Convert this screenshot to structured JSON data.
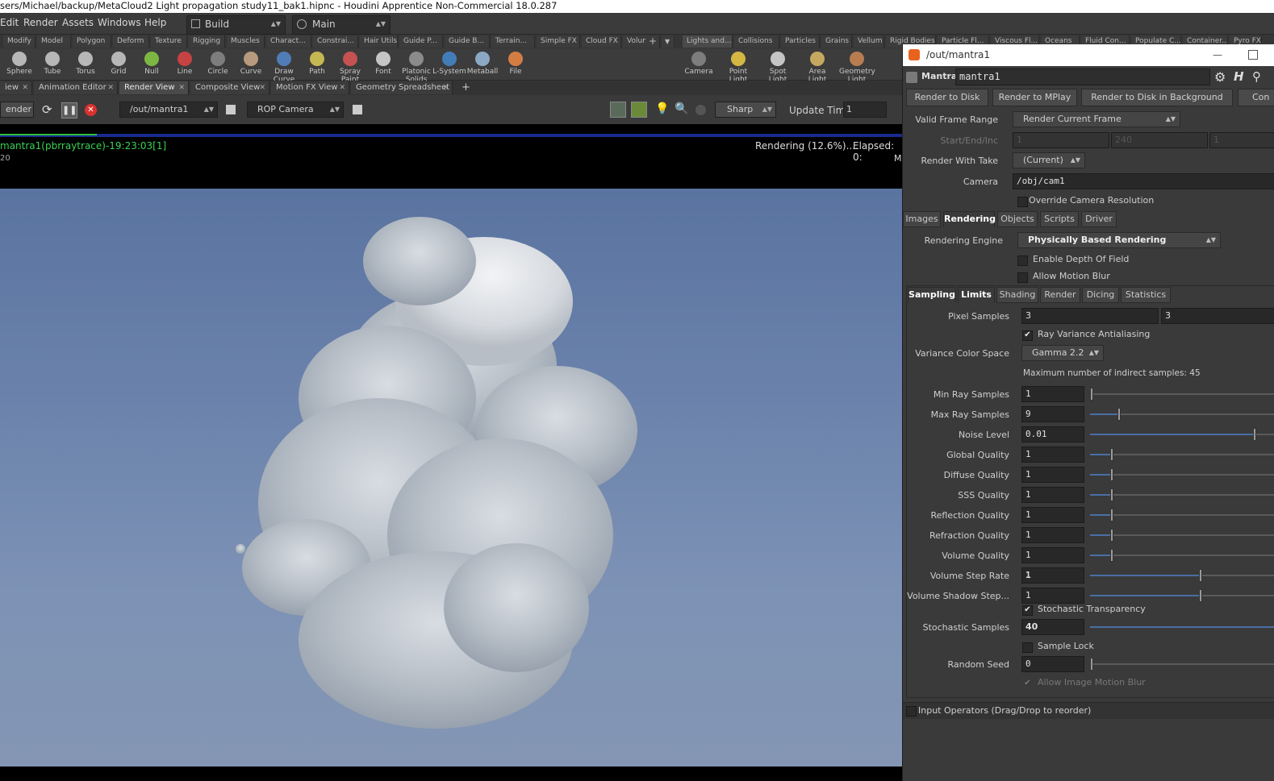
{
  "window": {
    "title": "sers/Michael/backup/MetaCloud2 Light propagation study11_bak1.hipnc - Houdini Apprentice Non-Commercial 18.0.287"
  },
  "menu": {
    "items": [
      "Edit",
      "Render",
      "Assets",
      "Windows",
      "Help"
    ],
    "desktop": "Build",
    "main": "Main"
  },
  "shelf_tabs_left": [
    "Modify",
    "Model",
    "Polygon",
    "Deform",
    "Texture",
    "Rigging",
    "Muscles",
    "Charact...",
    "Constrai...",
    "Hair Utils",
    "Guide P...",
    "Guide B...",
    "Terrain...",
    "Simple FX",
    "Cloud FX",
    "Volume"
  ],
  "shelf_tabs_right": [
    "Lights and...",
    "Collisions",
    "Particles",
    "Grains",
    "Vellum",
    "Rigid Bodies",
    "Particle Fl...",
    "Viscous Fl...",
    "Oceans",
    "Fluid Con...",
    "Populate C...",
    "Container...",
    "Pyro FX"
  ],
  "tools_left": [
    {
      "label": "Sphere",
      "icon": "sphere-icon"
    },
    {
      "label": "Tube",
      "icon": "tube-icon"
    },
    {
      "label": "Torus",
      "icon": "torus-icon"
    },
    {
      "label": "Grid",
      "icon": "grid-icon"
    },
    {
      "label": "Null",
      "icon": "null-icon"
    },
    {
      "label": "Line",
      "icon": "line-icon"
    },
    {
      "label": "Circle",
      "icon": "circle-icon"
    },
    {
      "label": "Curve",
      "icon": "curve-icon"
    },
    {
      "label": "Draw Curve",
      "icon": "draw-curve-icon"
    },
    {
      "label": "Path",
      "icon": "path-icon"
    },
    {
      "label": "Spray Paint",
      "icon": "spray-paint-icon"
    },
    {
      "label": "Font",
      "icon": "font-icon"
    },
    {
      "label": "Platonic Solids",
      "icon": "platonic-icon"
    },
    {
      "label": "L-System",
      "icon": "lsystem-icon"
    },
    {
      "label": "Metaball",
      "icon": "metaball-icon"
    },
    {
      "label": "File",
      "icon": "file-icon"
    }
  ],
  "tools_right": [
    {
      "label": "Camera",
      "icon": "camera-icon"
    },
    {
      "label": "Point Light",
      "icon": "point-light-icon"
    },
    {
      "label": "Spot Light",
      "icon": "spot-light-icon"
    },
    {
      "label": "Area Light",
      "icon": "area-light-icon"
    },
    {
      "label": "Geometry Light",
      "icon": "geometry-light-icon"
    }
  ],
  "pane_tabs": [
    "iew",
    "Animation Editor",
    "Render View",
    "Composite View",
    "Motion FX View",
    "Geometry Spreadsheet"
  ],
  "render_toolbar": {
    "render_label": "ender",
    "rop": "/out/mantra1",
    "camera": "ROP Camera",
    "sharp": "Sharp",
    "update_time_label": "Update Time",
    "update_time_value": "1"
  },
  "render_info": {
    "name": "mantra1(pbrraytrace)-19:23:03[1]",
    "frame": "20",
    "status": "Rendering (12.6%)....",
    "elapsed": "Elapsed: 0:",
    "mem": "M",
    "progress": 0.126
  },
  "param_panel": {
    "path": "/out/mantra1",
    "node_type": "Mantra",
    "node_name": "mantra1",
    "buttons": [
      "Render to Disk",
      "Render to MPlay",
      "Render to Disk in Background",
      "Con"
    ],
    "valid_frame_range_label": "Valid Frame Range",
    "valid_frame_range": "Render Current Frame",
    "start_end_inc_label": "Start/End/Inc",
    "start": "1",
    "end": "240",
    "inc": "1",
    "render_with_take_label": "Render With Take",
    "render_with_take": "(Current)",
    "camera_label": "Camera",
    "camera": "/obj/cam1",
    "override_cam_res": "Override Camera Resolution",
    "tabs": [
      "Images",
      "Rendering",
      "Objects",
      "Scripts",
      "Driver"
    ],
    "rendering_engine_label": "Rendering Engine",
    "rendering_engine": "Physically Based Rendering",
    "enable_dof": "Enable Depth Of Field",
    "allow_motion_blur": "Allow Motion Blur",
    "subtabs": [
      "Sampling",
      "Limits",
      "Shading",
      "Render",
      "Dicing",
      "Statistics"
    ],
    "pixel_samples_label": "Pixel Samples",
    "pixel_samples_x": "3",
    "pixel_samples_y": "3",
    "ray_variance_aa": "Ray Variance Antialiasing",
    "variance_color_space_label": "Variance Color Space",
    "variance_color_space": "Gamma 2.2",
    "max_indirect": "Maximum number of indirect samples: 45",
    "rows": [
      {
        "label": "Min Ray Samples",
        "value": "1",
        "level": 0.0
      },
      {
        "label": "Max Ray Samples",
        "value": "9",
        "level": 0.15
      },
      {
        "label": "Noise Level",
        "value": "0.01",
        "level": 0.88
      },
      {
        "label": "Global Quality",
        "value": "1",
        "level": 0.11
      },
      {
        "label": "Diffuse Quality",
        "value": "1",
        "level": 0.11
      },
      {
        "label": "SSS Quality",
        "value": "1",
        "level": 0.11
      },
      {
        "label": "Reflection Quality",
        "value": "1",
        "level": 0.11
      },
      {
        "label": "Refraction Quality",
        "value": "1",
        "level": 0.11
      },
      {
        "label": "Volume Quality",
        "value": "1",
        "level": 0.11
      },
      {
        "label": "Volume Step Rate",
        "value": "1",
        "level": 0.59
      },
      {
        "label": "Volume Shadow Step...",
        "value": "1",
        "level": 0.59
      }
    ],
    "stochastic_transparency": "Stochastic Transparency",
    "stochastic_samples_label": "Stochastic Samples",
    "stochastic_samples": "40",
    "sample_lock": "Sample Lock",
    "random_seed_label": "Random Seed",
    "random_seed": "0",
    "allow_image_mb": "Allow Image Motion Blur",
    "input_operators": "Input Operators (Drag/Drop to reorder)"
  },
  "colors": {
    "sky_top": "#5a73a0",
    "sky_bottom": "#8496b4",
    "progress_blue": "#1a2a90",
    "progress_green": "#2fbf3e",
    "status_green": "#39d353"
  }
}
